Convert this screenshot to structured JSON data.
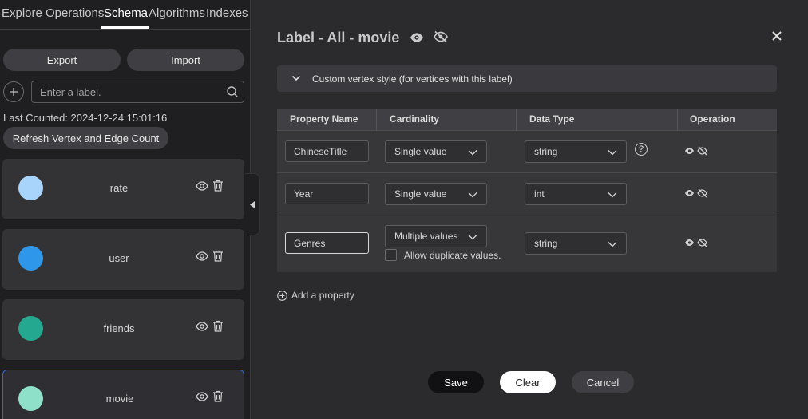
{
  "sidebar": {
    "tabs": [
      {
        "label": "Explore"
      },
      {
        "label": "Operations"
      },
      {
        "label": "Schema"
      },
      {
        "label": "Algorithms"
      },
      {
        "label": "Indexes"
      }
    ],
    "active_tab": "Schema",
    "export_label": "Export",
    "import_label": "Import",
    "add_icon": "plus-icon",
    "search_placeholder": "Enter a label.",
    "last_counted": "Last Counted: 2024-12-24 15:01:16",
    "refresh_label": "Refresh Vertex and Edge Count",
    "labels": [
      {
        "name": "rate",
        "color": "#a8d4fb"
      },
      {
        "name": "user",
        "color": "#2f97e9"
      },
      {
        "name": "friends",
        "color": "#24a88f"
      },
      {
        "name": "movie",
        "color": "#8fe0c8"
      }
    ],
    "selected_label": "movie"
  },
  "panel": {
    "title": "Label - All - movie",
    "collapse_text": "Custom vertex style (for vertices with this label)",
    "columns": [
      "Property Name",
      "Cardinality",
      "Data Type",
      "Operation"
    ],
    "rows": [
      {
        "name": "ChineseTitle",
        "cardinality": "Single value",
        "type": "string",
        "help": "?"
      },
      {
        "name": "Year",
        "cardinality": "Single value",
        "type": "int"
      },
      {
        "name": "Genres",
        "cardinality": "Multiple values",
        "type": "string",
        "allow_dup": "Allow duplicate values."
      }
    ],
    "add_property": "Add a property",
    "save_label": "Save",
    "clear_label": "Clear",
    "cancel_label": "Cancel"
  }
}
